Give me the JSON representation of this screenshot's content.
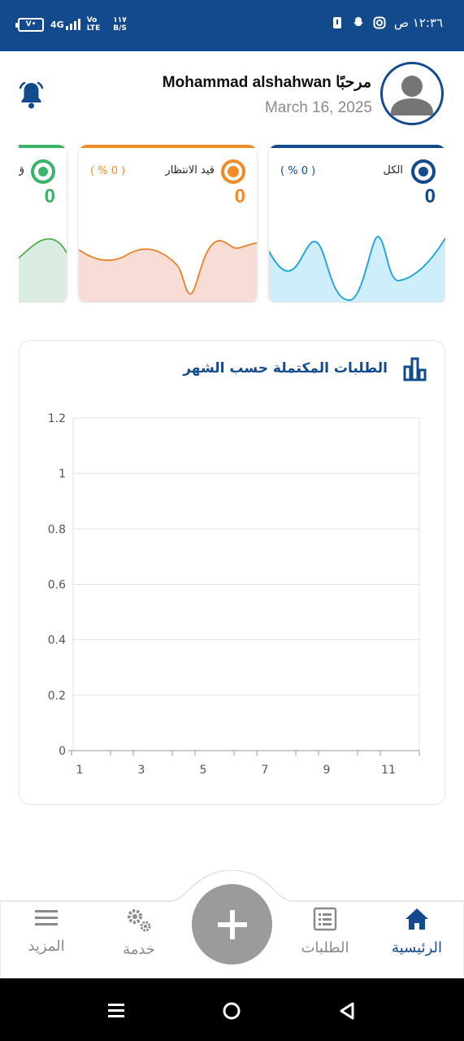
{
  "status_bar": {
    "battery": "V•",
    "network": "4G",
    "volte_top": "Vo",
    "volte_bottom": "LTE",
    "speed_top": "١١٧",
    "speed_bottom": "B/S",
    "time": "١٢:٣٦ ص"
  },
  "header": {
    "greeting": "Mohammad alshahwan مرحبًا",
    "date": "March 16, 2025"
  },
  "cards": [
    {
      "label": "الكل",
      "percent": "( % 0 )",
      "count": "0",
      "color": "#134a8e",
      "fill": "#cfeefc",
      "line": "#2aa7d9"
    },
    {
      "label": "قيد الانتظار",
      "percent": "( % 0 )",
      "count": "0",
      "color": "#f28c28",
      "fill": "#f8ddd6",
      "line": "#e8822a"
    },
    {
      "label": "ق",
      "percent": "",
      "count": "0",
      "color": "#3bb36a",
      "fill": "#dbece0",
      "line": "#4caf50"
    }
  ],
  "monthly_panel": {
    "title": "الطلبات المكتملة حسب الشهر"
  },
  "chart_data": {
    "type": "line",
    "title": "الطلبات المكتملة حسب الشهر",
    "x_ticks": [
      "1",
      "3",
      "5",
      "7",
      "9",
      "11"
    ],
    "y_ticks": [
      "0",
      "0.2",
      "0.4",
      "0.6",
      "0.8",
      "1",
      "1.2"
    ],
    "ylim": [
      0,
      1.2
    ],
    "xlim": [
      1,
      12
    ],
    "series": [],
    "grid": true
  },
  "nav": {
    "home": "الرئيسية",
    "requests": "الطلبات",
    "service": "خدمة",
    "more": "المزيد"
  },
  "colors": {
    "primary": "#134a8e",
    "inactive": "#8a8a8a",
    "fab": "#9b9b9b"
  },
  "icons": {
    "bell": "bell-icon",
    "avatar": "user-avatar-icon",
    "chart": "bar-chart-icon",
    "home": "home-icon",
    "requests": "document-list-icon",
    "service": "gears-icon",
    "more": "menu-icon",
    "add": "plus-icon"
  }
}
